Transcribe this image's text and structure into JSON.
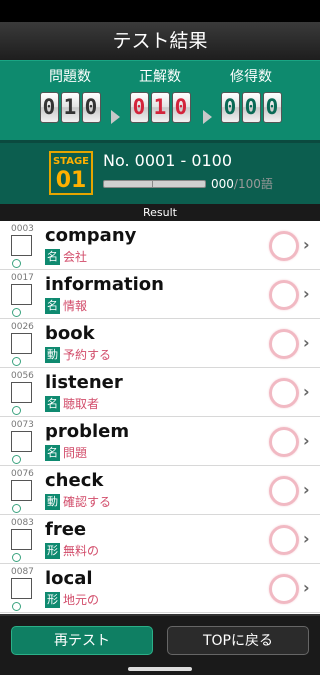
{
  "header": {
    "title": "テスト結果"
  },
  "score": {
    "questions": {
      "label": "問題数",
      "digits": [
        "0",
        "1",
        "0"
      ]
    },
    "correct": {
      "label": "正解数",
      "digits": [
        "0",
        "1",
        "0"
      ]
    },
    "learned": {
      "label": "修得数",
      "digits": [
        "0",
        "0",
        "0"
      ]
    }
  },
  "stage": {
    "badge_top": "STAGE",
    "badge_num": "01",
    "range": "No. 0001 - 0100",
    "progress_value": "000",
    "progress_slash": "/",
    "progress_total": "100語",
    "progress_fraction": 0.0
  },
  "result_label": "Result",
  "words": [
    {
      "num": "0003",
      "word": "company",
      "pos": "名",
      "meaning": "会社"
    },
    {
      "num": "0017",
      "word": "information",
      "pos": "名",
      "meaning": "情報"
    },
    {
      "num": "0026",
      "word": "book",
      "pos": "動",
      "meaning": "予約する"
    },
    {
      "num": "0056",
      "word": "listener",
      "pos": "名",
      "meaning": "聴取者"
    },
    {
      "num": "0073",
      "word": "problem",
      "pos": "名",
      "meaning": "問題"
    },
    {
      "num": "0076",
      "word": "check",
      "pos": "動",
      "meaning": "確認する"
    },
    {
      "num": "0083",
      "word": "free",
      "pos": "形",
      "meaning": "無料の"
    },
    {
      "num": "0087",
      "word": "local",
      "pos": "形",
      "meaning": "地元の"
    }
  ],
  "buttons": {
    "retest": "再テスト",
    "top": "TOPに戻る"
  },
  "icons": {
    "chevron": "chevron-right-icon",
    "ring": "correct-circle-icon"
  },
  "colors": {
    "accent": "#0e8a6e",
    "wrong_red": "#d3243b",
    "meaning": "#d24c6a"
  }
}
